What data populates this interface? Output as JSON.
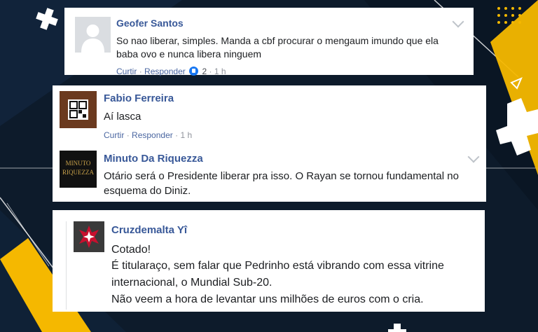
{
  "colors": {
    "background": "#0c1a2a",
    "accent_yellow": "#f5b800",
    "name_blue": "#385898"
  },
  "comments": [
    {
      "author": "Geofer Santos",
      "text_line1": "So nao liberar, simples. Manda a cbf procurar o mengaum imundo que ela",
      "text_line2": "baba ovo e nunca libera ninguem",
      "reply_label": "Curtir",
      "respond_label": "Responder",
      "separator": "·",
      "reactions": "2",
      "time": "1 h"
    },
    {
      "author": "Fabio Ferreira",
      "text_line1": "Aí lasca",
      "reply_label": "Curtir",
      "respond_label": "Responder",
      "separator": "·",
      "time": "1 h"
    },
    {
      "author": "Minuto Da Riquezza",
      "avatar_text": "MINUTO RIQUEZZA",
      "text_line1": "Otário será o Presidente liberar pra isso. O Rayan se tornou fundamental no",
      "text_line2": "esquema do Diniz."
    },
    {
      "author": "Cruzdemalta Yî",
      "text_line1": "Cotado!",
      "text_line2": "É titularaço, sem falar que Pedrinho está vibrando com essa vitrine",
      "text_line3": "internacional, o Mundial Sub-20.",
      "text_line4": "Não veem a hora de levantar uns milhões de euros com o cria."
    }
  ]
}
